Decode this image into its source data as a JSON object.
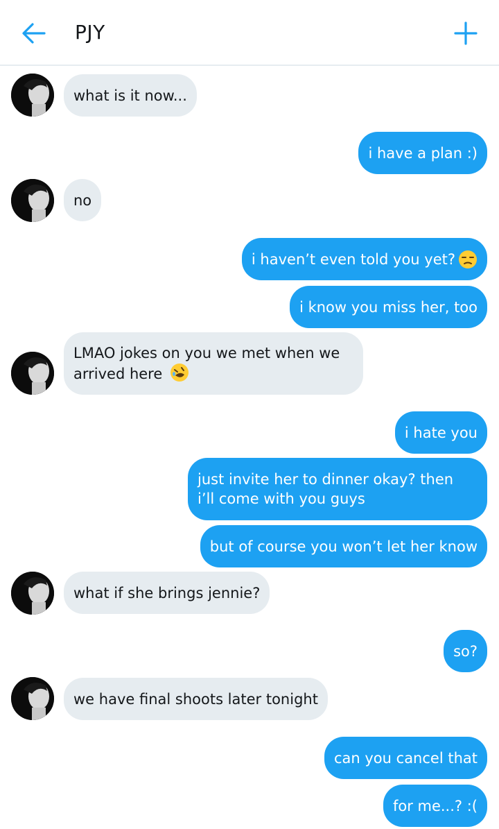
{
  "header": {
    "title": "PJY",
    "back_icon": "arrow-left-icon",
    "add_icon": "plus-icon",
    "accent": "#1da1f2"
  },
  "colors": {
    "incoming_bubble": "#e6ecf0",
    "outgoing_bubble": "#1da1f2"
  },
  "messages": [
    {
      "from": "them",
      "text": "what is it now..."
    },
    {
      "from": "me",
      "text": "i have a plan :)"
    },
    {
      "from": "them",
      "text": "no"
    },
    {
      "from": "me",
      "text": "i haven’t even told you yet?",
      "emoji": "unamused-face"
    },
    {
      "from": "me",
      "text": "i know you miss her, too"
    },
    {
      "from": "them",
      "line1": "LMAO jokes on you we met when we",
      "line2": "arrived here",
      "emoji": "rolling-on-floor-laughing"
    },
    {
      "from": "me",
      "text": "i hate you"
    },
    {
      "from": "me",
      "line1": "just invite her to dinner okay? then",
      "line2": "i’ll come with you guys"
    },
    {
      "from": "me",
      "text": "but of course you won’t let her know"
    },
    {
      "from": "them",
      "text": "what if she brings jennie?"
    },
    {
      "from": "me",
      "text": "so?"
    },
    {
      "from": "them",
      "text": "we have final shoots later tonight"
    },
    {
      "from": "me",
      "text": "can you cancel that"
    },
    {
      "from": "me",
      "text": "for me...? :("
    }
  ]
}
